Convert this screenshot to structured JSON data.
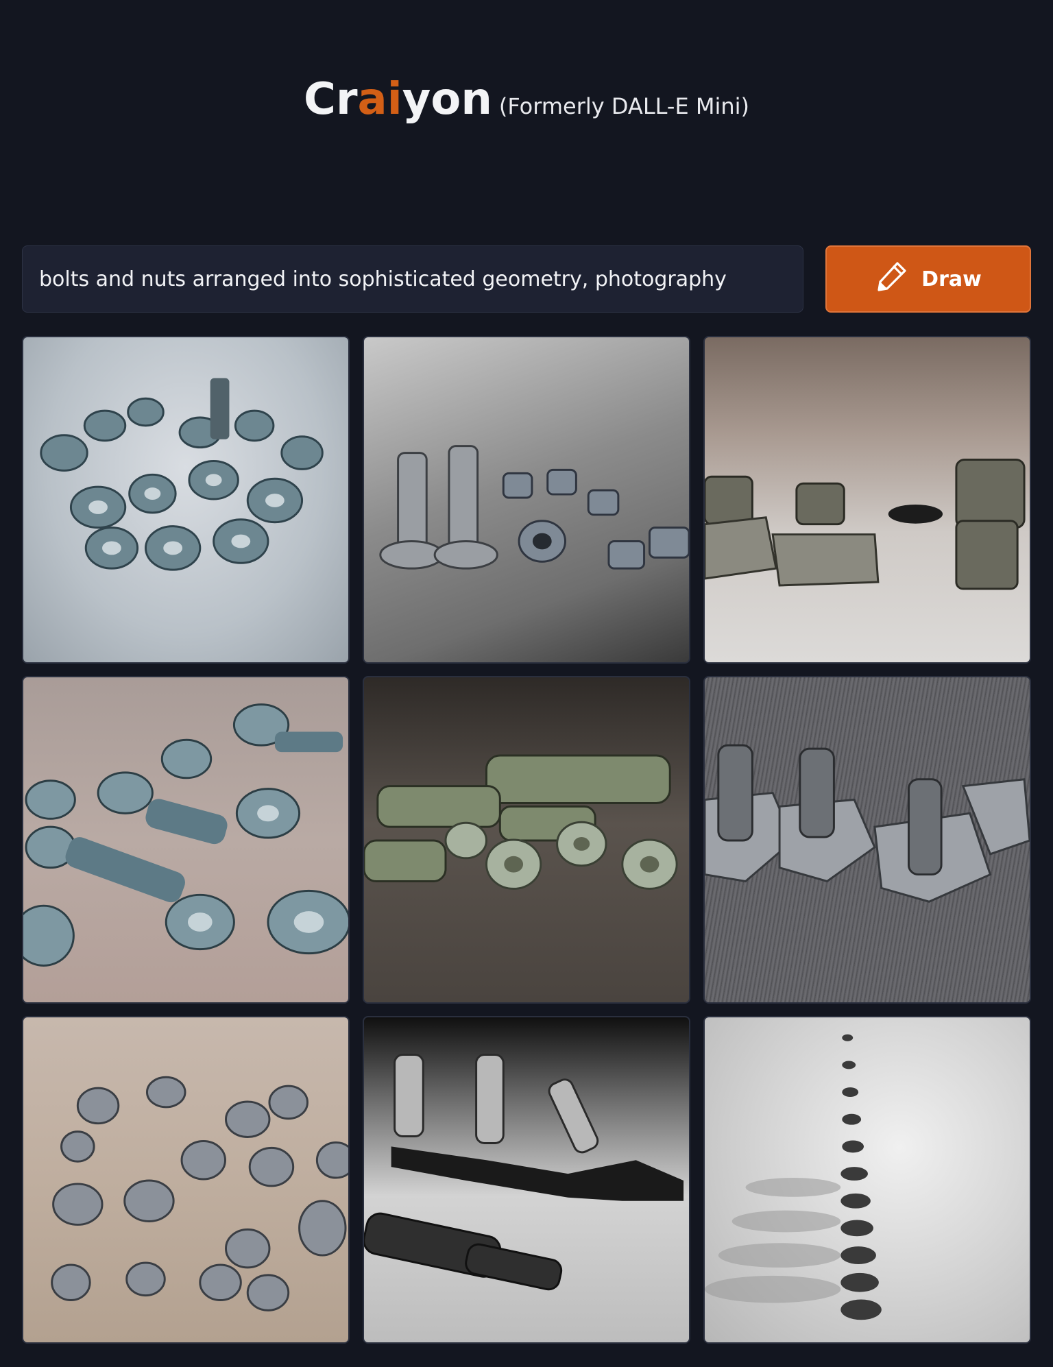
{
  "header": {
    "logo_parts": [
      "Cr",
      "ai",
      "yon"
    ],
    "tagline": "(Formerly DALL-E Mini)",
    "accent_color": "#d35f16"
  },
  "prompt": {
    "value": "bolts and nuts arranged into sophisticated geometry, photography"
  },
  "draw_button": {
    "label": "Draw",
    "icon": "pencil-icon",
    "color": "#cf5716"
  },
  "images": [
    {
      "alt": "pile of nuts and bolts"
    },
    {
      "alt": "two bolts and nuts on grey surface"
    },
    {
      "alt": "hex nuts with bolts close-up"
    },
    {
      "alt": "scattered bolts on pink surface"
    },
    {
      "alt": "bolts on dark surface"
    },
    {
      "alt": "nuts on ribbed grey surface"
    },
    {
      "alt": "scattered nuts on beige fabric"
    },
    {
      "alt": "black and white bolts with shadows"
    },
    {
      "alt": "column of nuts blurred"
    }
  ]
}
